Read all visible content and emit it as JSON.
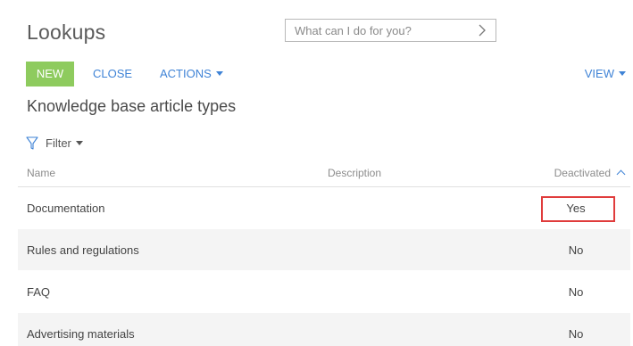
{
  "page": {
    "title": "Lookups"
  },
  "command": {
    "placeholder": "What can I do for you?",
    "go_icon": "chevron-right-icon"
  },
  "toolbar": {
    "new_label": "NEW",
    "close_label": "CLOSE",
    "actions_label": "ACTIONS",
    "view_label": "VIEW",
    "accent_color": "#8ecb5e",
    "link_color": "#3f83d6"
  },
  "section": {
    "title": "Knowledge base article types"
  },
  "filter": {
    "label": "Filter",
    "icon": "funnel-icon"
  },
  "grid": {
    "columns": [
      "Name",
      "Description",
      "Deactivated"
    ],
    "sorted_column": "Deactivated",
    "sort_direction": "ascending",
    "rows": [
      {
        "name": "Documentation",
        "description": "",
        "deactivated": "Yes"
      },
      {
        "name": "Rules and regulations",
        "description": "",
        "deactivated": "No"
      },
      {
        "name": "FAQ",
        "description": "",
        "deactivated": "No"
      },
      {
        "name": "Advertising materials",
        "description": "",
        "deactivated": "No"
      }
    ],
    "highlighted_cell_color": "#e03c3c"
  }
}
